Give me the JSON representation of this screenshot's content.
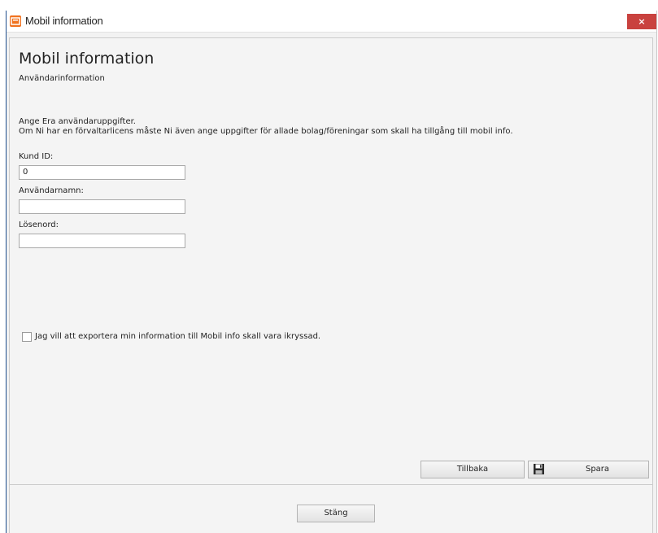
{
  "window": {
    "title": "Mobil information",
    "close_glyph": "×",
    "accent_color": "#c9423f",
    "app_icon": "app-icon"
  },
  "header": {
    "heading": "Mobil information",
    "subheading": "Användarinformation"
  },
  "form": {
    "intro_line1": "Ange Era användaruppgifter.",
    "intro_line2": "Om Ni har en förvaltarlicens måste Ni även ange uppgifter för allade bolag/föreningar som skall ha tillgång till mobil info.",
    "customer_id": {
      "label": "Kund ID:",
      "value": "0"
    },
    "username": {
      "label": "Användarnamn:",
      "value": ""
    },
    "password": {
      "label": "Lösenord:",
      "value": ""
    },
    "export_checkbox": {
      "label": "Jag vill att exportera min information till Mobil info skall vara ikryssad.",
      "checked": false
    }
  },
  "buttons": {
    "back": "Tillbaka",
    "save": "Spara",
    "save_icon": "floppy-disk-icon",
    "close": "Stäng"
  }
}
